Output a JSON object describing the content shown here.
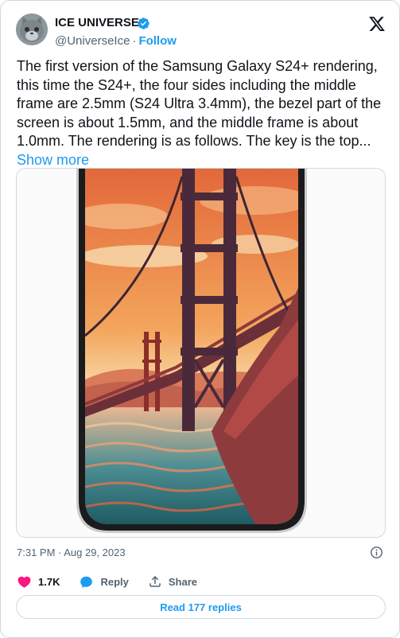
{
  "author": {
    "name": "ICE UNIVERSE",
    "handle": "@UniverseIce",
    "separator": "·",
    "follow_label": "Follow"
  },
  "tweet": {
    "text": "The first version of the Samsung Galaxy S24+ rendering, this time the S24+, the four sides including the middle frame are 2.5mm (S24 Ultra 3.4mm), the bezel part of the screen is about 1.5mm, and the middle frame is about 1.0mm. The rendering is as follows. The key is the top...",
    "show_more_label": "Show more",
    "timestamp": "7:31 PM · Aug 29, 2023"
  },
  "actions": {
    "like_count": "1.7K",
    "reply_label": "Reply",
    "share_label": "Share"
  },
  "read_replies_label": "Read 177 replies",
  "colors": {
    "accent": "#1d9bf0",
    "like": "#f91880",
    "text": "#0f1419",
    "muted": "#536471",
    "border": "#cfd9de"
  },
  "icons": [
    "x-logo-icon",
    "verified-badge-icon",
    "info-icon",
    "heart-icon",
    "reply-bubble-icon",
    "share-icon"
  ]
}
